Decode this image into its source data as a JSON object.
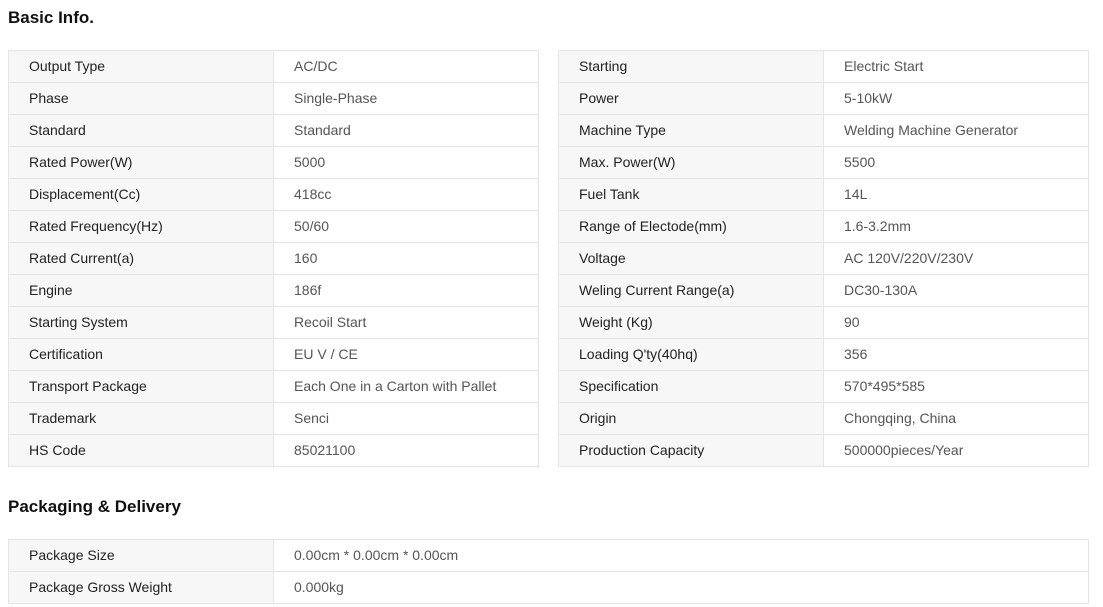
{
  "basic_info": {
    "title": "Basic Info.",
    "left": [
      {
        "label": "Output Type",
        "value": "AC/DC"
      },
      {
        "label": "Phase",
        "value": "Single-Phase"
      },
      {
        "label": "Standard",
        "value": "Standard"
      },
      {
        "label": "Rated Power(W)",
        "value": "5000"
      },
      {
        "label": "Displacement(Cc)",
        "value": "418cc"
      },
      {
        "label": "Rated Frequency(Hz)",
        "value": "50/60"
      },
      {
        "label": "Rated Current(a)",
        "value": "160"
      },
      {
        "label": "Engine",
        "value": "186f"
      },
      {
        "label": "Starting System",
        "value": "Recoil Start"
      },
      {
        "label": "Certification",
        "value": "EU V / CE"
      },
      {
        "label": "Transport Package",
        "value": "Each One in a Carton with Pallet"
      },
      {
        "label": "Trademark",
        "value": "Senci"
      },
      {
        "label": "HS Code",
        "value": "85021100"
      }
    ],
    "right": [
      {
        "label": "Starting",
        "value": "Electric Start"
      },
      {
        "label": "Power",
        "value": "5-10kW"
      },
      {
        "label": "Machine Type",
        "value": "Welding Machine Generator"
      },
      {
        "label": "Max. Power(W)",
        "value": "5500"
      },
      {
        "label": "Fuel Tank",
        "value": "14L"
      },
      {
        "label": "Range of Electode(mm)",
        "value": "1.6-3.2mm"
      },
      {
        "label": "Voltage",
        "value": "AC 120V/220V/230V"
      },
      {
        "label": "Weling Current Range(a)",
        "value": "DC30-130A"
      },
      {
        "label": "Weight (Kg)",
        "value": "90"
      },
      {
        "label": "Loading Q'ty(40hq)",
        "value": "356"
      },
      {
        "label": "Specification",
        "value": "570*495*585"
      },
      {
        "label": "Origin",
        "value": "Chongqing, China"
      },
      {
        "label": "Production Capacity",
        "value": "500000pieces/Year"
      }
    ]
  },
  "packaging": {
    "title": "Packaging & Delivery",
    "rows": [
      {
        "label": "Package Size",
        "value": "0.00cm * 0.00cm * 0.00cm"
      },
      {
        "label": "Package Gross Weight",
        "value": "0.000kg"
      }
    ]
  }
}
